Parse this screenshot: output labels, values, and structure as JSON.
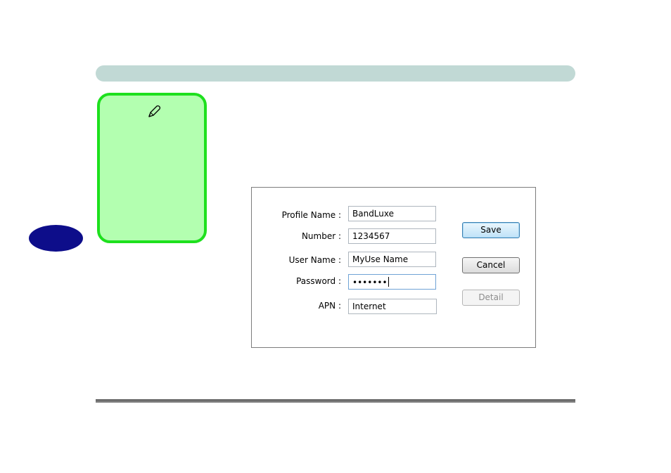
{
  "form": {
    "profile_name": {
      "label": "Profile Name :",
      "value": "BandLuxe"
    },
    "number": {
      "label": "Number :",
      "value": "1234567"
    },
    "user_name": {
      "label": "User Name :",
      "value": "MyUse Name"
    },
    "password": {
      "label": "Password :",
      "value": "•••••••"
    },
    "apn": {
      "label": "APN :",
      "value": "Internet"
    }
  },
  "buttons": {
    "save_label": "Save",
    "cancel_label": "Cancel",
    "detail_label": "Detail"
  },
  "icons": {
    "note": "pencil-icon"
  },
  "colors": {
    "header_bar": "#c1d9d5",
    "note_fill": "#b3ffb0",
    "note_border": "#1ee01e",
    "chapter_tab": "#0d0d8a"
  }
}
